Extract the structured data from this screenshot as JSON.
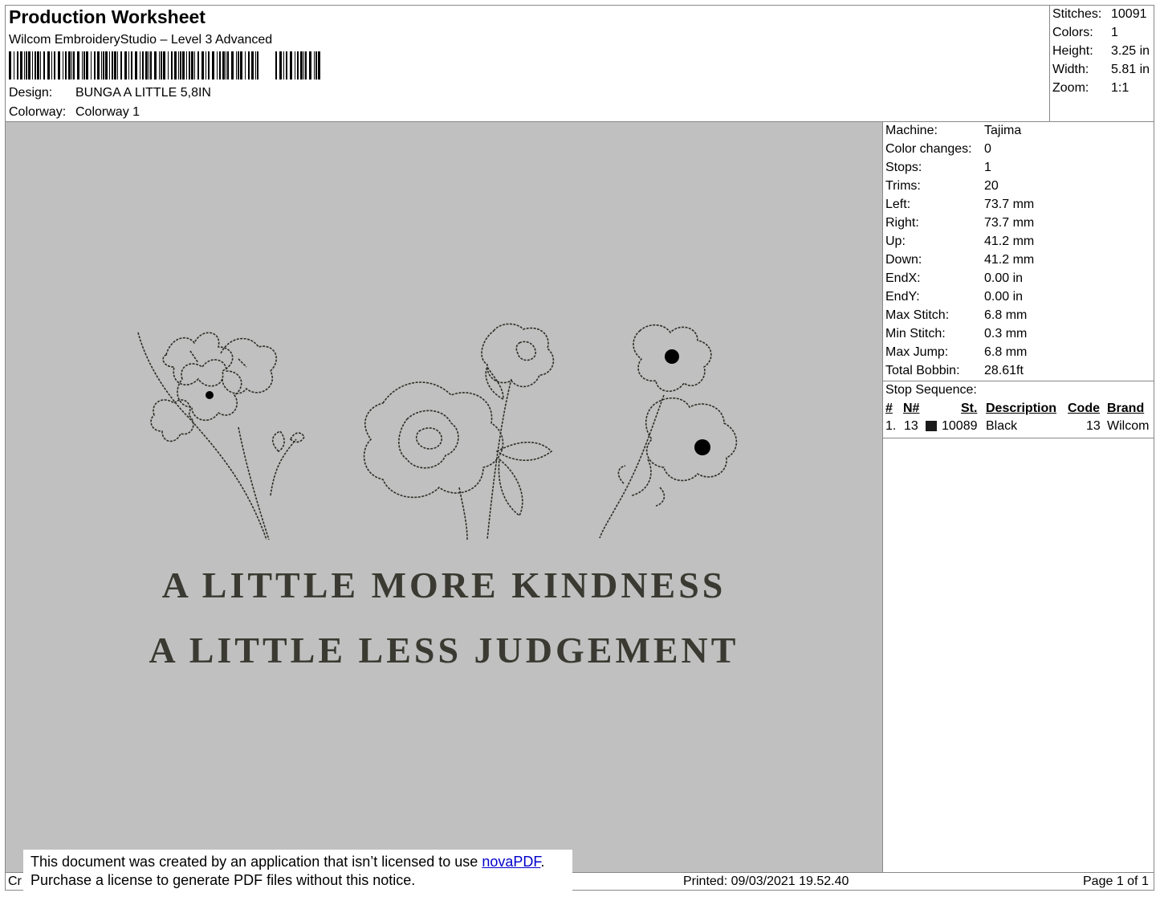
{
  "header": {
    "title": "Production Worksheet",
    "software": "Wilcom EmbroideryStudio – Level 3 Advanced",
    "design_label": "Design:",
    "design_value": "BUNGA A LITTLE 5,8IN",
    "colorway_label": "Colorway:",
    "colorway_value": "Colorway 1"
  },
  "stats": [
    {
      "label": "Stitches:",
      "value": "10091"
    },
    {
      "label": "Colors:",
      "value": "1"
    },
    {
      "label": "Height:",
      "value": "3.25 in"
    },
    {
      "label": "Width:",
      "value": "5.81 in"
    },
    {
      "label": "Zoom:",
      "value": "1:1"
    }
  ],
  "machine_info": [
    {
      "label": "Machine:",
      "value": "Tajima"
    },
    {
      "label": "Color changes:",
      "value": "0"
    },
    {
      "label": "Stops:",
      "value": "1"
    },
    {
      "label": "Trims:",
      "value": "20"
    },
    {
      "label": "Left:",
      "value": "73.7 mm"
    },
    {
      "label": "Right:",
      "value": "73.7 mm"
    },
    {
      "label": "Up:",
      "value": "41.2 mm"
    },
    {
      "label": "Down:",
      "value": "41.2 mm"
    },
    {
      "label": "EndX:",
      "value": "0.00 in"
    },
    {
      "label": "EndY:",
      "value": "0.00 in"
    },
    {
      "label": "Max Stitch:",
      "value": "6.8 mm"
    },
    {
      "label": "Min Stitch:",
      "value": "0.3 mm"
    },
    {
      "label": "Max Jump:",
      "value": "6.8 mm"
    },
    {
      "label": "Total Bobbin:",
      "value": "28.61ft"
    }
  ],
  "stop_sequence": {
    "label": "Stop Sequence:",
    "columns": {
      "num": "#",
      "n": "N#",
      "st": "St.",
      "description": "Description",
      "code": "Code",
      "brand": "Brand"
    },
    "rows": [
      {
        "num": "1.",
        "n": "13",
        "swatch_color": "#1a1a1a",
        "st": "10089",
        "description": "Black",
        "code": "13",
        "brand": "Wilcom"
      }
    ]
  },
  "design_text": {
    "line1": "A LITTLE MORE KINDNESS",
    "line2": "A LITTLE LESS  JUDGEMENT"
  },
  "colors": {
    "fabric": "#c0c0c0",
    "thread": "#3a3a32"
  },
  "footer": {
    "left_fragment": "Cr",
    "printed": "Printed: 09/03/2021 19.52.40",
    "page": "Page 1 of 1"
  },
  "notice": {
    "line1_text": "This document was created by an application that isn’t licensed to use ",
    "link": "novaPDF",
    "line1_end": ".",
    "line2": "Purchase a license to generate PDF files without this notice."
  }
}
